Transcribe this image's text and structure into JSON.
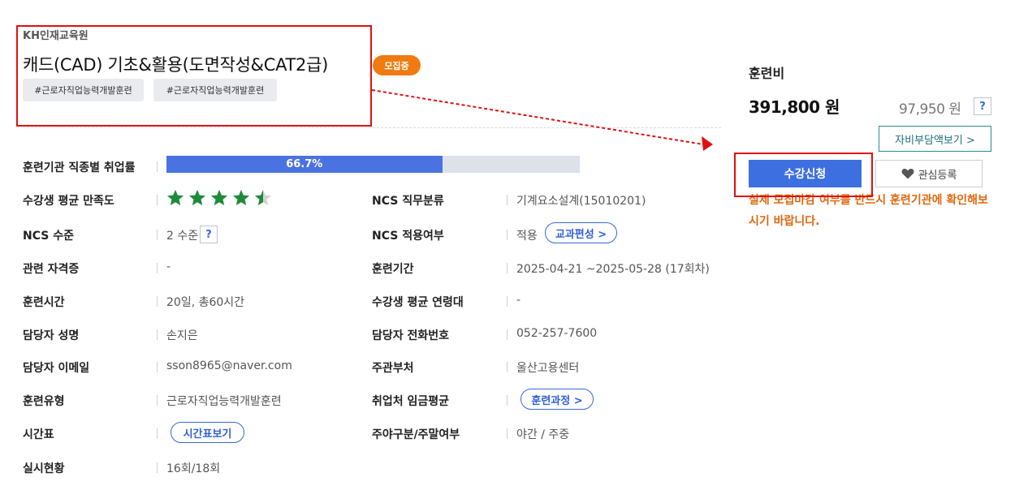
{
  "header": {
    "provider": "KH인재교육원",
    "title": "캐드(CAD) 기초&활용(도면작성&CAT2급)",
    "status_badge": "모집중",
    "tags": [
      "#근로자직업능력개발훈련",
      "#근로자직업능력개발훈련"
    ]
  },
  "details": {
    "employment_rate": {
      "label": "훈련기관 직종별 취업률",
      "value": "66.7%",
      "percent": 66.7
    },
    "satisfaction": {
      "label": "수강생 평균 만족도",
      "rating": 4.5,
      "max": 5
    },
    "ncs_category": {
      "label": "NCS 직무분류",
      "value": "기계요소설계(15010201)"
    },
    "ncs_level": {
      "label": "NCS 수준",
      "value": "2 수준",
      "help": "?"
    },
    "ncs_applied": {
      "label": "NCS 적용여부",
      "value": "적용",
      "button": "교과편성 >"
    },
    "certificate": {
      "label": "관련 자격증",
      "value": "-"
    },
    "period": {
      "label": "훈련기간",
      "value": "2025-04-21 ~2025-05-28 (17회차)"
    },
    "hours": {
      "label": "훈련시간",
      "value": "20일, 총60시간"
    },
    "avg_age": {
      "label": "수강생 평균 연령대",
      "value": "-"
    },
    "manager_name": {
      "label": "담당자 성명",
      "value": "손지은"
    },
    "manager_phone": {
      "label": "담당자 전화번호",
      "value": "052-257-7600"
    },
    "manager_email": {
      "label": "담당자 이메일",
      "value": "sson8965@naver.com"
    },
    "supervisor": {
      "label": "주관부처",
      "value": "울산고용센터"
    },
    "training_type": {
      "label": "훈련유형",
      "value": "근로자직업능력개발훈련"
    },
    "wage": {
      "label": "취업처 임금평균",
      "button": "훈련과정 >"
    },
    "timetable": {
      "label": "시간표",
      "button": "시간표보기"
    },
    "day_night": {
      "label": "주야구분/주말여부",
      "value": "야간 / 주중"
    },
    "status": {
      "label": "실시현황",
      "value": "16회/18회"
    }
  },
  "sidebar": {
    "fee_label": "훈련비",
    "fee_total": "391,800 원",
    "fee_self": "97,950 원",
    "fee_help": "?",
    "self_pay_button": "자비부담액보기 >",
    "apply_button": "수강신청",
    "favorite_button": "관심등록",
    "notice": "실제 모집마감 여부를 반드시 훈련기관에 확인해보시기 바랍니다."
  },
  "colors": {
    "accent": "#3d6fe0",
    "badge": "#f07b10",
    "notice": "#e0670e",
    "annotation": "#e01010",
    "star": "#1e8a3c"
  }
}
